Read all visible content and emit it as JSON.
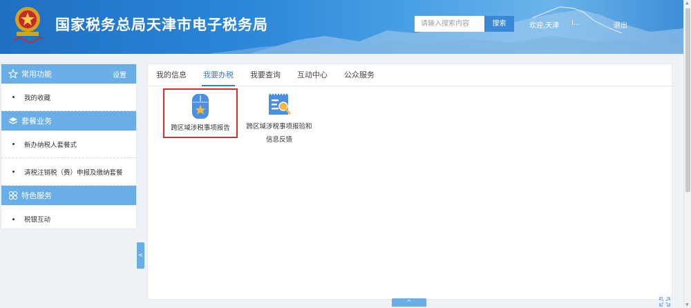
{
  "header": {
    "title": "国家税务总局天津市电子税务局",
    "search_placeholder": "请输入搜索内容",
    "search_button": "搜索",
    "welcome": "欢迎,天津",
    "user_sep": "I...",
    "logout": "退出"
  },
  "sidebar": {
    "sections": [
      {
        "title": "常用功能",
        "icon": "star-icon",
        "action": "设置",
        "items": [
          "我的收藏"
        ]
      },
      {
        "title": "套餐业务",
        "icon": "layers-icon",
        "items": [
          "新办纳税人套餐式",
          "清税注销税（费）申报及缴纳套餐"
        ]
      },
      {
        "title": "特色服务",
        "icon": "clover-icon",
        "items": [
          "税银互动"
        ]
      }
    ],
    "collapse_glyph": "<"
  },
  "main": {
    "tabs": [
      "我的信息",
      "我要办税",
      "我要查询",
      "互动中心",
      "公众服务"
    ],
    "active_tab": 1,
    "tiles": [
      {
        "label": "跨区域涉税事项报告",
        "icon": "mouse-badge-icon",
        "highlighted": true
      },
      {
        "label_line1": "跨区域涉税事项报验和",
        "label_line2": "信息反馈",
        "icon": "report-search-icon"
      }
    ]
  },
  "footer": {
    "toggle_glyph": "^"
  },
  "colors": {
    "accent": "#2f7fd6",
    "sidebar_head": "#6aaee8",
    "highlight": "#e02b2b"
  }
}
